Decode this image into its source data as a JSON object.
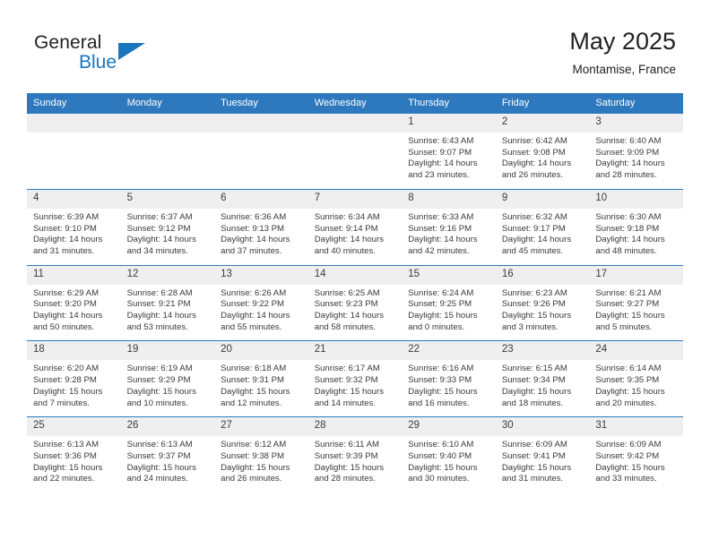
{
  "brand": {
    "name_part1": "General",
    "name_part2": "Blue",
    "logo_icon": "triangle-logo-icon"
  },
  "header": {
    "title": "May 2025",
    "subtitle": "Montamise, France"
  },
  "colors": {
    "header_blue": "#2e79bd",
    "daynum_gray": "#efefef",
    "brand_blue": "#1b75bb",
    "text": "#3a3a3a"
  },
  "weekday_headers": [
    "Sunday",
    "Monday",
    "Tuesday",
    "Wednesday",
    "Thursday",
    "Friday",
    "Saturday"
  ],
  "weeks": [
    [
      {
        "empty": true,
        "day": "",
        "sunrise": "",
        "sunset": "",
        "daylight1": "",
        "daylight2": ""
      },
      {
        "empty": true,
        "day": "",
        "sunrise": "",
        "sunset": "",
        "daylight1": "",
        "daylight2": ""
      },
      {
        "empty": true,
        "day": "",
        "sunrise": "",
        "sunset": "",
        "daylight1": "",
        "daylight2": ""
      },
      {
        "empty": true,
        "day": "",
        "sunrise": "",
        "sunset": "",
        "daylight1": "",
        "daylight2": ""
      },
      {
        "empty": false,
        "day": "1",
        "sunrise": "Sunrise: 6:43 AM",
        "sunset": "Sunset: 9:07 PM",
        "daylight1": "Daylight: 14 hours",
        "daylight2": "and 23 minutes."
      },
      {
        "empty": false,
        "day": "2",
        "sunrise": "Sunrise: 6:42 AM",
        "sunset": "Sunset: 9:08 PM",
        "daylight1": "Daylight: 14 hours",
        "daylight2": "and 26 minutes."
      },
      {
        "empty": false,
        "day": "3",
        "sunrise": "Sunrise: 6:40 AM",
        "sunset": "Sunset: 9:09 PM",
        "daylight1": "Daylight: 14 hours",
        "daylight2": "and 28 minutes."
      }
    ],
    [
      {
        "empty": false,
        "day": "4",
        "sunrise": "Sunrise: 6:39 AM",
        "sunset": "Sunset: 9:10 PM",
        "daylight1": "Daylight: 14 hours",
        "daylight2": "and 31 minutes."
      },
      {
        "empty": false,
        "day": "5",
        "sunrise": "Sunrise: 6:37 AM",
        "sunset": "Sunset: 9:12 PM",
        "daylight1": "Daylight: 14 hours",
        "daylight2": "and 34 minutes."
      },
      {
        "empty": false,
        "day": "6",
        "sunrise": "Sunrise: 6:36 AM",
        "sunset": "Sunset: 9:13 PM",
        "daylight1": "Daylight: 14 hours",
        "daylight2": "and 37 minutes."
      },
      {
        "empty": false,
        "day": "7",
        "sunrise": "Sunrise: 6:34 AM",
        "sunset": "Sunset: 9:14 PM",
        "daylight1": "Daylight: 14 hours",
        "daylight2": "and 40 minutes."
      },
      {
        "empty": false,
        "day": "8",
        "sunrise": "Sunrise: 6:33 AM",
        "sunset": "Sunset: 9:16 PM",
        "daylight1": "Daylight: 14 hours",
        "daylight2": "and 42 minutes."
      },
      {
        "empty": false,
        "day": "9",
        "sunrise": "Sunrise: 6:32 AM",
        "sunset": "Sunset: 9:17 PM",
        "daylight1": "Daylight: 14 hours",
        "daylight2": "and 45 minutes."
      },
      {
        "empty": false,
        "day": "10",
        "sunrise": "Sunrise: 6:30 AM",
        "sunset": "Sunset: 9:18 PM",
        "daylight1": "Daylight: 14 hours",
        "daylight2": "and 48 minutes."
      }
    ],
    [
      {
        "empty": false,
        "day": "11",
        "sunrise": "Sunrise: 6:29 AM",
        "sunset": "Sunset: 9:20 PM",
        "daylight1": "Daylight: 14 hours",
        "daylight2": "and 50 minutes."
      },
      {
        "empty": false,
        "day": "12",
        "sunrise": "Sunrise: 6:28 AM",
        "sunset": "Sunset: 9:21 PM",
        "daylight1": "Daylight: 14 hours",
        "daylight2": "and 53 minutes."
      },
      {
        "empty": false,
        "day": "13",
        "sunrise": "Sunrise: 6:26 AM",
        "sunset": "Sunset: 9:22 PM",
        "daylight1": "Daylight: 14 hours",
        "daylight2": "and 55 minutes."
      },
      {
        "empty": false,
        "day": "14",
        "sunrise": "Sunrise: 6:25 AM",
        "sunset": "Sunset: 9:23 PM",
        "daylight1": "Daylight: 14 hours",
        "daylight2": "and 58 minutes."
      },
      {
        "empty": false,
        "day": "15",
        "sunrise": "Sunrise: 6:24 AM",
        "sunset": "Sunset: 9:25 PM",
        "daylight1": "Daylight: 15 hours",
        "daylight2": "and 0 minutes."
      },
      {
        "empty": false,
        "day": "16",
        "sunrise": "Sunrise: 6:23 AM",
        "sunset": "Sunset: 9:26 PM",
        "daylight1": "Daylight: 15 hours",
        "daylight2": "and 3 minutes."
      },
      {
        "empty": false,
        "day": "17",
        "sunrise": "Sunrise: 6:21 AM",
        "sunset": "Sunset: 9:27 PM",
        "daylight1": "Daylight: 15 hours",
        "daylight2": "and 5 minutes."
      }
    ],
    [
      {
        "empty": false,
        "day": "18",
        "sunrise": "Sunrise: 6:20 AM",
        "sunset": "Sunset: 9:28 PM",
        "daylight1": "Daylight: 15 hours",
        "daylight2": "and 7 minutes."
      },
      {
        "empty": false,
        "day": "19",
        "sunrise": "Sunrise: 6:19 AM",
        "sunset": "Sunset: 9:29 PM",
        "daylight1": "Daylight: 15 hours",
        "daylight2": "and 10 minutes."
      },
      {
        "empty": false,
        "day": "20",
        "sunrise": "Sunrise: 6:18 AM",
        "sunset": "Sunset: 9:31 PM",
        "daylight1": "Daylight: 15 hours",
        "daylight2": "and 12 minutes."
      },
      {
        "empty": false,
        "day": "21",
        "sunrise": "Sunrise: 6:17 AM",
        "sunset": "Sunset: 9:32 PM",
        "daylight1": "Daylight: 15 hours",
        "daylight2": "and 14 minutes."
      },
      {
        "empty": false,
        "day": "22",
        "sunrise": "Sunrise: 6:16 AM",
        "sunset": "Sunset: 9:33 PM",
        "daylight1": "Daylight: 15 hours",
        "daylight2": "and 16 minutes."
      },
      {
        "empty": false,
        "day": "23",
        "sunrise": "Sunrise: 6:15 AM",
        "sunset": "Sunset: 9:34 PM",
        "daylight1": "Daylight: 15 hours",
        "daylight2": "and 18 minutes."
      },
      {
        "empty": false,
        "day": "24",
        "sunrise": "Sunrise: 6:14 AM",
        "sunset": "Sunset: 9:35 PM",
        "daylight1": "Daylight: 15 hours",
        "daylight2": "and 20 minutes."
      }
    ],
    [
      {
        "empty": false,
        "day": "25",
        "sunrise": "Sunrise: 6:13 AM",
        "sunset": "Sunset: 9:36 PM",
        "daylight1": "Daylight: 15 hours",
        "daylight2": "and 22 minutes."
      },
      {
        "empty": false,
        "day": "26",
        "sunrise": "Sunrise: 6:13 AM",
        "sunset": "Sunset: 9:37 PM",
        "daylight1": "Daylight: 15 hours",
        "daylight2": "and 24 minutes."
      },
      {
        "empty": false,
        "day": "27",
        "sunrise": "Sunrise: 6:12 AM",
        "sunset": "Sunset: 9:38 PM",
        "daylight1": "Daylight: 15 hours",
        "daylight2": "and 26 minutes."
      },
      {
        "empty": false,
        "day": "28",
        "sunrise": "Sunrise: 6:11 AM",
        "sunset": "Sunset: 9:39 PM",
        "daylight1": "Daylight: 15 hours",
        "daylight2": "and 28 minutes."
      },
      {
        "empty": false,
        "day": "29",
        "sunrise": "Sunrise: 6:10 AM",
        "sunset": "Sunset: 9:40 PM",
        "daylight1": "Daylight: 15 hours",
        "daylight2": "and 30 minutes."
      },
      {
        "empty": false,
        "day": "30",
        "sunrise": "Sunrise: 6:09 AM",
        "sunset": "Sunset: 9:41 PM",
        "daylight1": "Daylight: 15 hours",
        "daylight2": "and 31 minutes."
      },
      {
        "empty": false,
        "day": "31",
        "sunrise": "Sunrise: 6:09 AM",
        "sunset": "Sunset: 9:42 PM",
        "daylight1": "Daylight: 15 hours",
        "daylight2": "and 33 minutes."
      }
    ]
  ]
}
